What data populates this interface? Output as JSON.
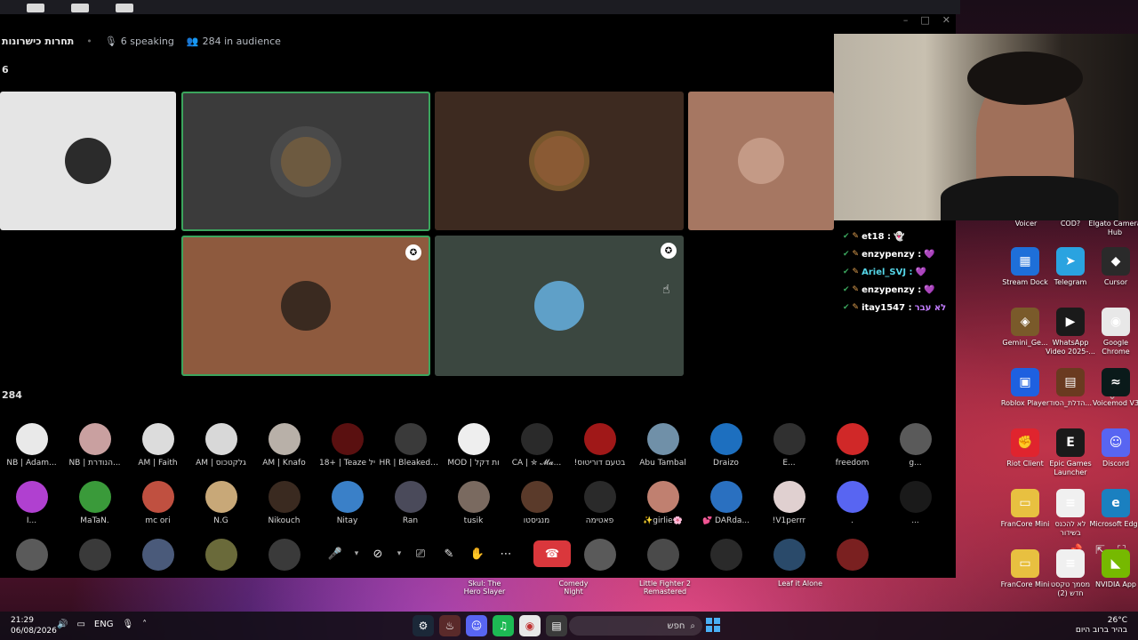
{
  "stage": {
    "title": "תחרות כישרונות",
    "speaking": "6 speaking",
    "audience": "284 in audience",
    "speakers_count": "6",
    "audience_count": "284"
  },
  "window_controls": {
    "minimize": "–",
    "maximize": "□",
    "close": "✕"
  },
  "speakers": [
    {
      "bg": "#e5e5e5",
      "avatar": "#2b2b2b",
      "speaking": false
    },
    {
      "bg": "#3b3b3b",
      "avatar": "#6d5a40",
      "speaking": true
    },
    {
      "bg": "#3d2a20",
      "avatar": "#8a5a34",
      "speaking": false
    },
    {
      "bg": "#a67762",
      "avatar": "#c49a86",
      "speaking": false
    },
    {
      "bg": "#8e5a3e",
      "avatar": "#3a2a20",
      "speaking": true
    },
    {
      "bg": "#3b4740",
      "avatar": "#5fa0c8",
      "speaking": false
    }
  ],
  "audience_rows": [
    [
      {
        "name": "NB | Adam...",
        "color": "#e9e9e9"
      },
      {
        "name": "NB | הנודרת...",
        "color": "#c9a0a0"
      },
      {
        "name": "AM | Faith",
        "color": "#dcdcdc"
      },
      {
        "name": "AM | גלקטכוס",
        "color": "#d8d8d8"
      },
      {
        "name": "AM | Knafo",
        "color": "#b8b0a8"
      },
      {
        "name": "18+ | Teaze יל",
        "color": "#5a1010"
      },
      {
        "name": "HR | BleakedA...",
        "color": "#3a3a3a"
      },
      {
        "name": "MOD | ות דקל",
        "color": "#eeeeee"
      },
      {
        "name": "CA | ✮ 𝓜𝓪...",
        "color": "#2a2a2a"
      },
      {
        "name": "!בטעם דוריטוס",
        "color": "#a01818"
      },
      {
        "name": "Abu Tambal",
        "color": "#7090a8"
      },
      {
        "name": "Draizo",
        "color": "#1d6fbf"
      },
      {
        "name": "E...",
        "color": "#303030"
      },
      {
        "name": "freedom",
        "color": "#d02828"
      },
      {
        "name": "g...",
        "color": "#5a5a5a"
      }
    ],
    [
      {
        "name": "I...",
        "color": "#b040d0"
      },
      {
        "name": "MaTaN.",
        "color": "#3a9a3a"
      },
      {
        "name": "mc ori",
        "color": "#c05040"
      },
      {
        "name": "N.G",
        "color": "#c8a878"
      },
      {
        "name": "Nikouch",
        "color": "#3a2a20"
      },
      {
        "name": "Nitay",
        "color": "#3a80c8"
      },
      {
        "name": "Ran",
        "color": "#4a4a5a"
      },
      {
        "name": "tusik",
        "color": "#7a6a60"
      },
      {
        "name": "מנגיסטו",
        "color": "#5a3a2a"
      },
      {
        "name": "פאטימה",
        "color": "#2a2a2a"
      },
      {
        "name": "✨girlie🌸",
        "color": "#c08070"
      },
      {
        "name": "💕 DARda...",
        "color": "#2a70c0"
      },
      {
        "name": "!V1perrr",
        "color": "#e0d0d0"
      },
      {
        "name": ".",
        "color": "#5865f2"
      },
      {
        "name": "...",
        "color": "#1a1a1a"
      }
    ],
    [
      {
        "name": "",
        "color": "#5a5a5a"
      },
      {
        "name": "",
        "color": "#3a3a3a"
      },
      {
        "name": "",
        "color": "#4a5a7a"
      },
      {
        "name": "",
        "color": "#6a6a3a"
      },
      {
        "name": "",
        "color": "#3a3a3a"
      },
      {
        "name": "",
        "color": "#000000"
      },
      {
        "name": "",
        "color": "#000000"
      },
      {
        "name": "",
        "color": "#000000"
      },
      {
        "name": "",
        "color": "#000000"
      },
      {
        "name": "",
        "color": "#5a5a5a"
      },
      {
        "name": "",
        "color": "#4a4a4a"
      },
      {
        "name": "",
        "color": "#2a2a2a"
      },
      {
        "name": "",
        "color": "#2a4a6a"
      },
      {
        "name": "",
        "color": "#7a2020"
      },
      {
        "name": "",
        "color": "#000000"
      }
    ]
  ],
  "chat": [
    {
      "user": "et18 :",
      "color": "#ffffff",
      "msg": "👻"
    },
    {
      "user": "enzypenzy :",
      "color": "#ffffff",
      "msg": "💜"
    },
    {
      "user": "Ariel_SVJ :",
      "color": "#55d6e8",
      "msg": "💜"
    },
    {
      "user": "enzypenzy :",
      "color": "#ffffff",
      "msg": "💜"
    },
    {
      "user": "itay1547 :",
      "color": "#ffffff",
      "msg": "לא עבר"
    }
  ],
  "desktop_icons": [
    {
      "label": "Stream Dock",
      "color": "#1e6fd9",
      "glyph": "▦"
    },
    {
      "label": "Telegram",
      "color": "#2aa3e0",
      "glyph": "➤"
    },
    {
      "label": "Cursor",
      "color": "#2a2a2a",
      "glyph": "◆"
    },
    {
      "label": "Gemini_Ge...",
      "color": "#7a5a2a",
      "glyph": "◈"
    },
    {
      "label": "WhatsApp Video 2025-...",
      "color": "#1a1a1a",
      "glyph": "▶"
    },
    {
      "label": "Google Chrome",
      "color": "#e8e8e8",
      "glyph": "◉"
    },
    {
      "label": "Roblox Player",
      "color": "#1e60e0",
      "glyph": "▣"
    },
    {
      "label": "הדלת_הסוד...",
      "color": "#6a3a20",
      "glyph": "▤"
    },
    {
      "label": "Voicemod V3",
      "color": "#0a1a1a",
      "glyph": "≈"
    },
    {
      "label": "Riot Client",
      "color": "#e0242e",
      "glyph": "✊"
    },
    {
      "label": "Epic Games Launcher",
      "color": "#1a1a1a",
      "glyph": "E"
    },
    {
      "label": "Discord",
      "color": "#5865f2",
      "glyph": "☺"
    },
    {
      "label": "FranCore Mini",
      "color": "#e8c040",
      "glyph": "▭"
    },
    {
      "label": "לא להכנס בשידור",
      "color": "#f0f0f0",
      "glyph": "≡"
    },
    {
      "label": "Microsoft Edge",
      "color": "#1a80c0",
      "glyph": "e"
    },
    {
      "label": "FranCore Mini",
      "color": "#e8c040",
      "glyph": "▭"
    },
    {
      "label": "מסמך טקסט חדש (2)",
      "color": "#f0f0f0",
      "glyph": "≡"
    },
    {
      "label": "NVIDIA App",
      "color": "#76b900",
      "glyph": "◣"
    }
  ],
  "top_desktop_labels": [
    "Voicer",
    "COD?",
    "Elgato Camera Hub"
  ],
  "background_labels": [
    "Skul: The Hero Slayer",
    "Comedy Night",
    "Little Fighter 2 Remastered",
    "Leaf it Alone"
  ],
  "taskbar": {
    "time": "21:29",
    "date": "06/08/2026",
    "lang": "ENG",
    "search_placeholder": "חפש",
    "temperature": "26°C",
    "weather": "בהיר ברוב היום",
    "notif_count": "8"
  }
}
